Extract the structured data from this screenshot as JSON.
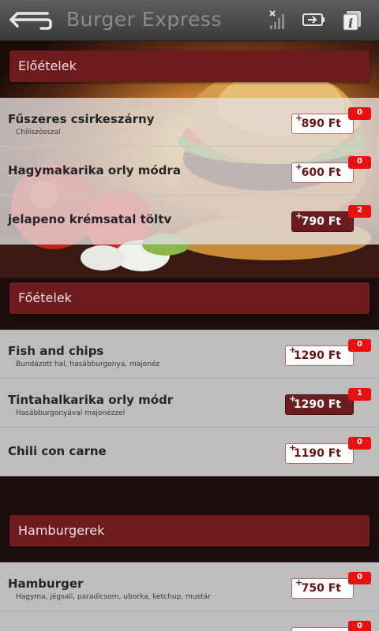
{
  "app": {
    "title": "Burger Express"
  },
  "categories": [
    {
      "title": "Előételek",
      "items": [
        {
          "name": "Fűszeres csirkeszárny",
          "desc": "Chiliszósszal",
          "price": "890 Ft",
          "plus": "+",
          "count": "0"
        },
        {
          "name": "Hagymakarika orly módra",
          "desc": "",
          "price": "600 Ft",
          "plus": "+",
          "count": "0"
        },
        {
          "name": "jelapeno krémsatal töltv",
          "desc": "",
          "price": "790 Ft",
          "plus": "+",
          "count": "2"
        }
      ]
    },
    {
      "title": "Főételek",
      "items": [
        {
          "name": "Fish and chips",
          "desc": "Bundázott hal, hasábburgonya, majonéz",
          "price": "1290 Ft",
          "plus": "+",
          "count": "0"
        },
        {
          "name": "Tintahalkarika orly módr",
          "desc": "Hasábburgonyával majonézzel",
          "price": "1290 Ft",
          "plus": "+",
          "count": "1"
        },
        {
          "name": "Chili con carne",
          "desc": "",
          "price": "1190 Ft",
          "plus": "+",
          "count": "0"
        }
      ]
    },
    {
      "title": "Hamburgerek",
      "items": [
        {
          "name": "Hamburger",
          "desc": "Hagyma, jégsali, paradicsom, uborka, ketchup, mustár",
          "price": "750 Ft",
          "plus": "+",
          "count": "0"
        },
        {
          "name": "",
          "desc": "",
          "price": "",
          "plus": "",
          "count": "0"
        }
      ]
    }
  ],
  "icons": [
    "back-arrow-icon",
    "no-signal-icon",
    "battery-icon",
    "info-icon"
  ]
}
